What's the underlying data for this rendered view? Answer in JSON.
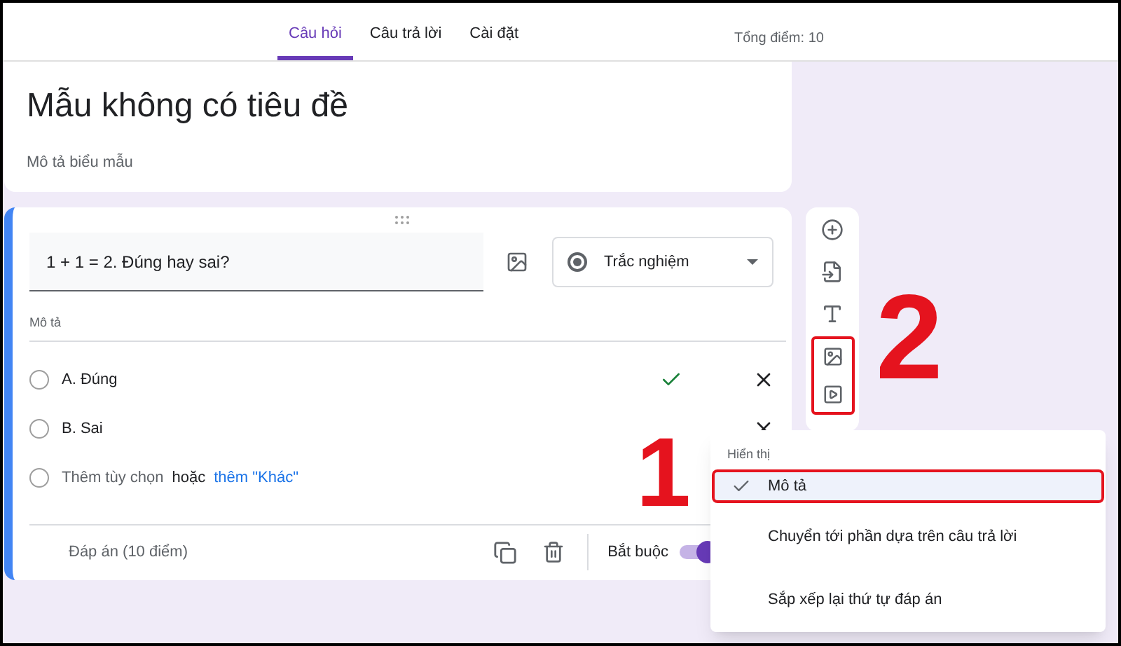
{
  "tabs": [
    {
      "label": "Câu hỏi",
      "selected": true
    },
    {
      "label": "Câu trả lời",
      "selected": false
    },
    {
      "label": "Cài đặt",
      "selected": false
    }
  ],
  "total_points": "Tổng điểm: 10",
  "form_header": {
    "title": "Mẫu không có tiêu đề",
    "description_placeholder": "Mô tả biểu mẫu"
  },
  "question": {
    "title": "1 + 1 = 2. Đúng hay sai?",
    "type": "Trắc nghiệm",
    "description_placeholder": "Mô tả",
    "options": [
      {
        "label": "A. Đúng",
        "correct": true,
        "selected": false
      },
      {
        "label": "B. Sai",
        "correct": false,
        "selected": false
      }
    ],
    "add_option": "Thêm tùy chọn",
    "add_option_selected": false,
    "or": "hoặc",
    "add_other": "thêm \"Khác\"",
    "answer_key": "Đáp án (10 điểm)",
    "required_label": "Bắt buộc",
    "required": true
  },
  "menu": {
    "heading": "Hiển thị",
    "items": [
      {
        "label": "Mô tả",
        "checked": true,
        "highlighted": true
      },
      {
        "label": "Chuyển tới phần dựa trên câu trả lời",
        "checked": false,
        "highlighted": false
      },
      {
        "label": "Sắp xếp lại thứ tự đáp án",
        "checked": false,
        "highlighted": false
      }
    ]
  },
  "annotations": [
    {
      "label": "1"
    },
    {
      "label": "2"
    }
  ]
}
